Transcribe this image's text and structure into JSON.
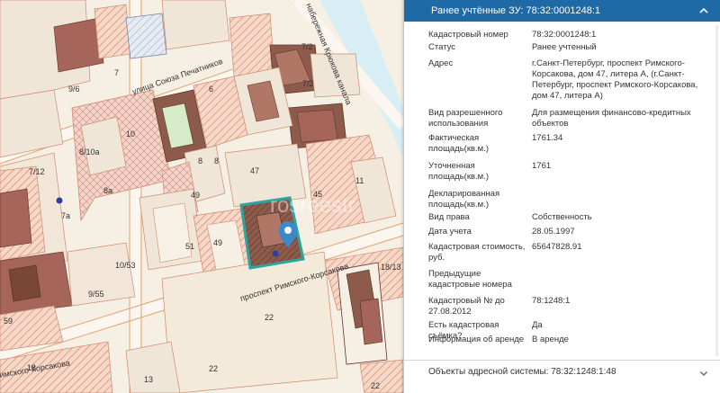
{
  "map": {
    "lot_labels": [
      "9/6",
      "7",
      "7/2",
      "7/2",
      "6",
      "10",
      "8/10а",
      "7/12",
      "8а",
      "7а",
      "8",
      "8",
      "49",
      "47",
      "45",
      "11",
      "51",
      "49",
      "10/53",
      "9/55",
      "59",
      "22",
      "18/13",
      "22",
      "18",
      "13",
      "22"
    ],
    "street_labels": [
      "улица Союза Печатников",
      "набережная Крюкова канала",
      "проспект Римского-Корсакова",
      "имского-Корсакова"
    ],
    "watermark": "rosreestr"
  },
  "panel": {
    "title": "Ранее учтённые ЗУ: 78:32:0001248:1",
    "rows": [
      {
        "key": "Кадастровый номер",
        "value": "78:32:0001248:1"
      },
      {
        "key": "Статус",
        "value": "Ранее учтенный"
      },
      {
        "key": "Адрес",
        "value": "г.Санкт-Петербург, проспект Римского-Корсакова, дом 47, литера А, (г.Санкт-Петербург, проспект Римского-Корсакова, дом 47, литера А)"
      },
      {
        "key": "Вид разрешенного использования",
        "value": "Для размещения финансово-кредитных объектов"
      },
      {
        "key": "Фактическая площадь(кв.м.)",
        "value": "1761.34"
      },
      {
        "key": "Уточненная площадь(кв.м.)",
        "value": "1761"
      },
      {
        "key": "Декларированная площадь(кв.м.)",
        "value": ""
      },
      {
        "key": "Вид права",
        "value": "Собственность"
      },
      {
        "key": "Дата учета",
        "value": "28.05.1997"
      },
      {
        "key": "Кадастровая стоимость, руб.",
        "value": "65647828.91"
      },
      {
        "key": "Предыдущие кадастровые номера",
        "value": ""
      },
      {
        "key": "Кадастровый № до 27.08.2012",
        "value": "78:1248:1"
      },
      {
        "key": "Есть кадастровая съёмка?",
        "value": "Да"
      },
      {
        "key": "Информация об аренде",
        "value": "В аренде"
      }
    ],
    "footer_title": "Объекты адресной системы: 78:32:1248:1:48"
  },
  "colors": {
    "header_bg": "#1e6aa6",
    "selected_parcel": "#2aa5a0",
    "parcel_hatch": "#e2755d",
    "water": "#d6eef4",
    "marker": "#3a89c9"
  }
}
